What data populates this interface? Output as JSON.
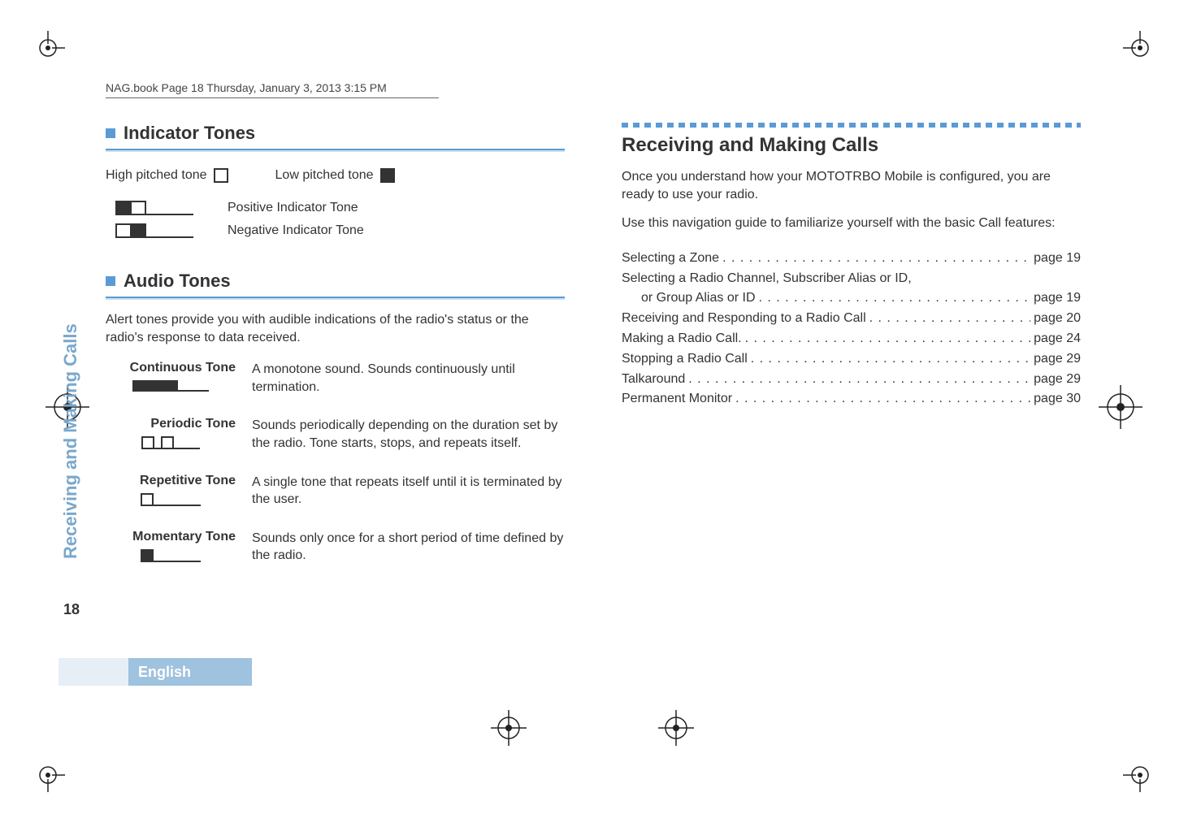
{
  "header": {
    "running": "NAG.book  Page 18  Thursday, January 3, 2013  3:15 PM"
  },
  "left": {
    "indicator": {
      "heading": "Indicator Tones",
      "high_label": "High pitched tone",
      "low_label": "Low pitched tone",
      "positive": "Positive Indicator Tone",
      "negative": "Negative Indicator Tone"
    },
    "audio": {
      "heading": "Audio Tones",
      "intro": "Alert tones provide you with audible indications of the radio's status or the radio's response to data received.",
      "rows": [
        {
          "label": "Continuous Tone",
          "desc": "A monotone sound. Sounds continuously until termination."
        },
        {
          "label": "Periodic Tone",
          "desc": "Sounds periodically depending on the duration set by the radio. Tone starts, stops, and repeats itself."
        },
        {
          "label": "Repetitive Tone",
          "desc": "A single tone that repeats itself until it is terminated by the user."
        },
        {
          "label": "Momentary Tone",
          "desc": "Sounds only once for a short period of time defined by the radio."
        }
      ]
    }
  },
  "right": {
    "title": "Receiving and Making Calls",
    "p1": "Once you understand how your MOTOTRBO Mobile is configured, you are ready to use your radio.",
    "p2": "Use this navigation guide to familiarize yourself with the basic Call features:",
    "toc": [
      {
        "label": "Selecting a Zone",
        "page": "page 19"
      },
      {
        "label": "Selecting a Radio Channel, Subscriber Alias or ID,",
        "sub": "or Group Alias or ID",
        "page": "page 19"
      },
      {
        "label": "Receiving and Responding to a Radio Call",
        "page": "page 20"
      },
      {
        "label": "Making a Radio Call.",
        "page": "page 24"
      },
      {
        "label": "Stopping a Radio Call",
        "page": "page 29"
      },
      {
        "label": "Talkaround",
        "page": "page 29"
      },
      {
        "label": "Permanent Monitor",
        "page": "page 30"
      }
    ]
  },
  "sidebar": {
    "vtext": "Receiving and Making Calls",
    "pagenum": "18",
    "lang": "English"
  }
}
